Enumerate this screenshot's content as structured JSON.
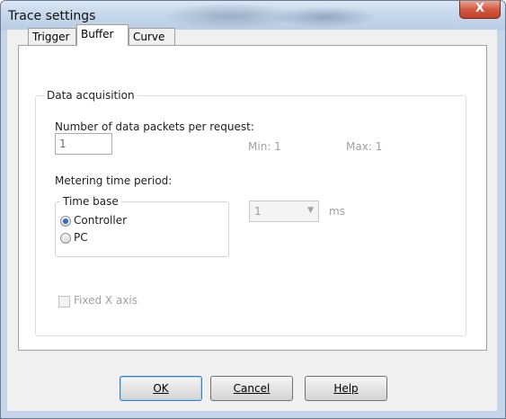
{
  "window": {
    "title": "Trace settings",
    "close_glyph": "X"
  },
  "tabs": [
    {
      "label": "Trigger",
      "active": false
    },
    {
      "label": "Buffer",
      "active": true
    },
    {
      "label": "Curve",
      "active": false
    }
  ],
  "data_acquisition": {
    "group_title": "Data acquisition",
    "packets_label": "Number of data packets per request:",
    "packets_value": "1",
    "min_label": "Min: 1",
    "max_label": "Max: 1",
    "metering_label": "Metering time period:",
    "time_base": {
      "group_title": "Time base",
      "options": [
        {
          "label": "Controller",
          "selected": true
        },
        {
          "label": "PC",
          "selected": false
        }
      ]
    },
    "period_value": "1",
    "period_unit": "ms",
    "fixed_x_axis_label": "Fixed X axis",
    "fixed_x_axis_checked": false
  },
  "buttons": {
    "ok": "OK",
    "cancel": "Cancel",
    "help": "Help"
  },
  "colors": {
    "titlebar": "#c6d8ec",
    "close_button": "#c33e27",
    "dialog_background": "#f0f0f0",
    "radio_selected": "#2f6fb8"
  }
}
